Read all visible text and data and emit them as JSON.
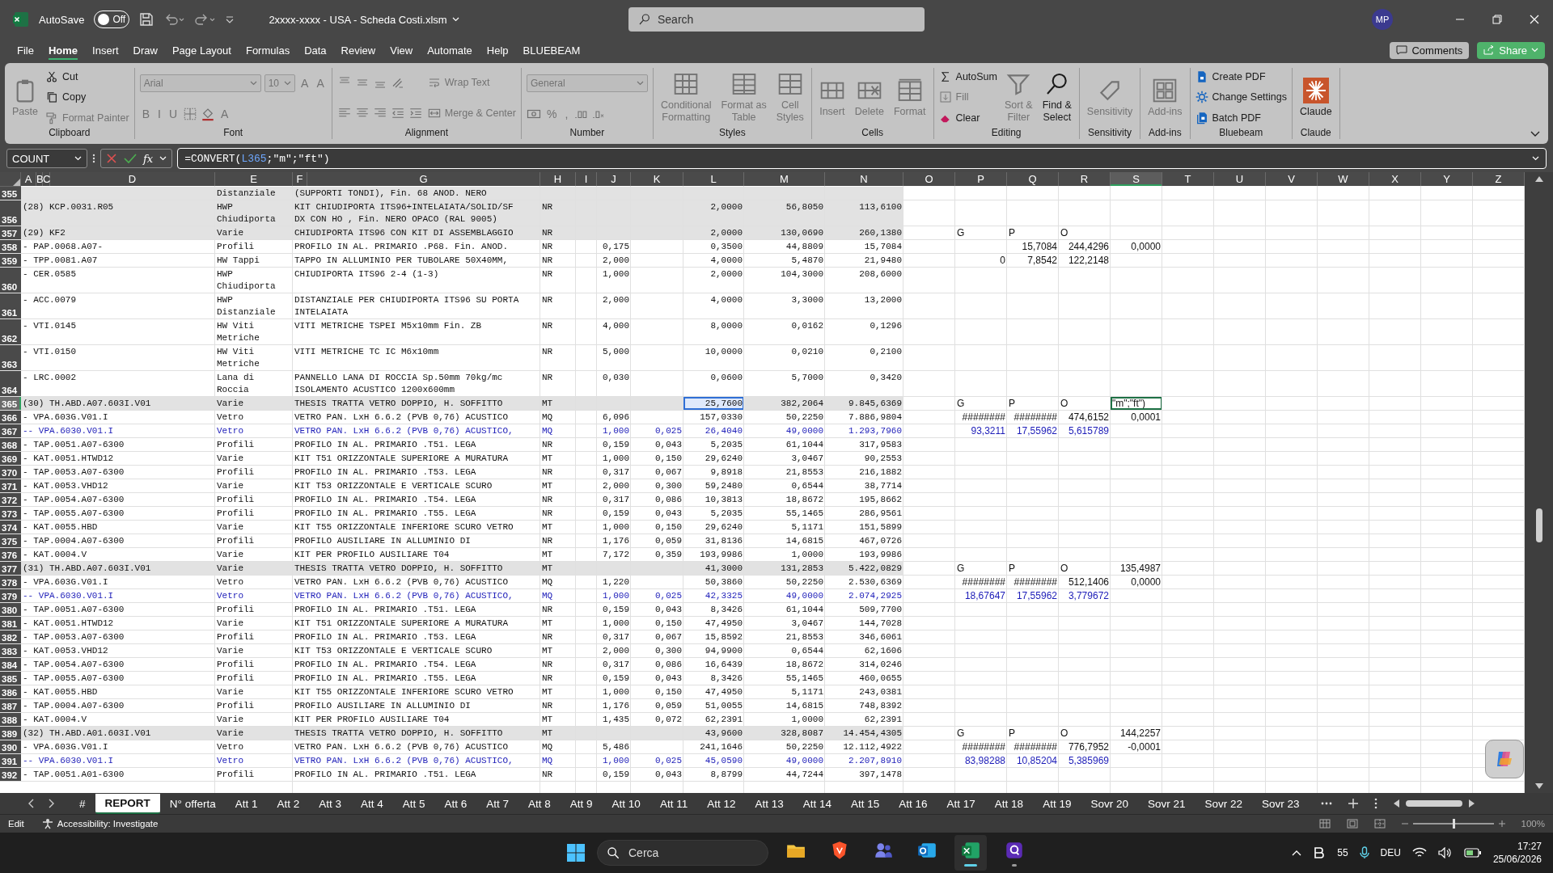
{
  "title_bar": {
    "autosave": {
      "label": "AutoSave",
      "on": false,
      "state_label": "Off"
    },
    "file_name": "2xxxx-xxxx - USA - Scheda Costi.xlsm",
    "search": {
      "placeholder": "Search"
    },
    "avatar": "MP"
  },
  "menu": {
    "tabs": [
      {
        "label": "File",
        "selected": false
      },
      {
        "label": "Home",
        "selected": true
      },
      {
        "label": "Insert",
        "selected": false
      },
      {
        "label": "Draw",
        "selected": false
      },
      {
        "label": "Page Layout",
        "selected": false
      },
      {
        "label": "Formulas",
        "selected": false
      },
      {
        "label": "Data",
        "selected": false
      },
      {
        "label": "Review",
        "selected": false
      },
      {
        "label": "View",
        "selected": false
      },
      {
        "label": "Automate",
        "selected": false
      },
      {
        "label": "Help",
        "selected": false
      },
      {
        "label": "BLUEBEAM",
        "selected": false
      }
    ],
    "comments": "Comments",
    "share": "Share"
  },
  "ribbon": [
    {
      "label": "Clipboard",
      "stacks": [
        [
          {
            "kind": "large",
            "label": "Paste",
            "disabled": true
          }
        ],
        [
          {
            "kind": "small",
            "label": "Cut",
            "disabled": false
          },
          {
            "kind": "small",
            "label": "Copy",
            "disabled": false
          },
          {
            "kind": "small",
            "label": "Format Painter",
            "disabled": true
          }
        ]
      ]
    },
    {
      "label": "Font",
      "stacks": [
        [
          {
            "kind": "row",
            "items": [
              {
                "kind": "select",
                "label": "Arial",
                "disabled": true
              },
              {
                "kind": "select",
                "label": "10",
                "disabled": true
              },
              {
                "kind": "glyph",
                "label": "A",
                "disabled": true
              },
              {
                "kind": "glyph",
                "label": "A",
                "disabled": true
              }
            ]
          },
          {
            "kind": "row",
            "items": [
              {
                "kind": "glyph",
                "label": "B",
                "disabled": true
              },
              {
                "kind": "glyph",
                "label": "I",
                "disabled": true
              },
              {
                "kind": "glyph",
                "label": "U",
                "disabled": true
              },
              {
                "kind": "icon",
                "disabled": true
              },
              {
                "kind": "icon",
                "disabled": true
              },
              {
                "kind": "glyph",
                "label": "A",
                "disabled": true
              }
            ]
          }
        ]
      ]
    },
    {
      "label": "Alignment",
      "stacks": [
        [
          {
            "kind": "row",
            "items": [
              {
                "kind": "icon",
                "disabled": true
              },
              {
                "kind": "icon",
                "disabled": true
              },
              {
                "kind": "icon",
                "disabled": true
              },
              {
                "kind": "icon",
                "disabled": true
              }
            ]
          },
          {
            "kind": "row",
            "items": [
              {
                "kind": "icon",
                "disabled": true
              },
              {
                "kind": "icon",
                "disabled": true
              },
              {
                "kind": "icon",
                "disabled": true
              },
              {
                "kind": "icon",
                "disabled": true
              },
              {
                "kind": "icon",
                "disabled": true
              }
            ]
          }
        ],
        [
          {
            "kind": "small",
            "label": "Wrap Text",
            "disabled": true
          },
          {
            "kind": "small",
            "label": "Merge & Center",
            "disabled": true
          }
        ]
      ]
    },
    {
      "label": "Number",
      "stacks": [
        [
          {
            "kind": "select",
            "label": "General",
            "disabled": true
          },
          {
            "kind": "row",
            "items": [
              {
                "kind": "icon",
                "disabled": true
              },
              {
                "kind": "glyph",
                "label": "%",
                "disabled": true
              },
              {
                "kind": "glyph",
                "label": ",",
                "disabled": true
              },
              {
                "kind": "icon",
                "disabled": true
              },
              {
                "kind": "icon",
                "disabled": true
              }
            ]
          }
        ]
      ]
    },
    {
      "label": "Styles",
      "stacks": [
        [
          {
            "kind": "large",
            "label": "Conditional\nFormatting",
            "disabled": true
          }
        ],
        [
          {
            "kind": "large",
            "label": "Format as\nTable",
            "disabled": true
          }
        ],
        [
          {
            "kind": "large",
            "label": "Cell\nStyles",
            "disabled": true
          }
        ]
      ]
    },
    {
      "label": "Cells",
      "stacks": [
        [
          {
            "kind": "large",
            "label": "Insert",
            "disabled": true
          }
        ],
        [
          {
            "kind": "large",
            "label": "Delete",
            "disabled": true
          }
        ],
        [
          {
            "kind": "large",
            "label": "Format",
            "disabled": true
          }
        ]
      ]
    },
    {
      "label": "Editing",
      "stacks": [
        [
          {
            "kind": "small",
            "label": "AutoSum",
            "disabled": false
          },
          {
            "kind": "small",
            "label": "Fill",
            "disabled": true
          },
          {
            "kind": "small",
            "label": "Clear",
            "disabled": false
          }
        ],
        [
          {
            "kind": "large",
            "label": "Sort &\nFilter",
            "disabled": true
          }
        ],
        [
          {
            "kind": "large",
            "label": "Find &\nSelect",
            "disabled": false
          }
        ]
      ]
    },
    {
      "label": "Sensitivity",
      "stacks": [
        [
          {
            "kind": "large",
            "label": "Sensitivity",
            "disabled": true
          }
        ]
      ]
    },
    {
      "label": "Add-ins",
      "stacks": [
        [
          {
            "kind": "large",
            "label": "Add-ins",
            "disabled": true
          }
        ]
      ]
    },
    {
      "label": "Bluebeam",
      "stacks": [
        [
          {
            "kind": "small",
            "label": "Create PDF",
            "disabled": false
          },
          {
            "kind": "small",
            "label": "Change Settings",
            "disabled": false
          },
          {
            "kind": "small",
            "label": "Batch PDF",
            "disabled": false
          }
        ]
      ]
    },
    {
      "label": "Claude",
      "stacks": [
        [
          {
            "kind": "large",
            "label": "Claude",
            "disabled": false
          }
        ]
      ]
    }
  ],
  "formula_bar": {
    "name_box": "COUNT",
    "function_label": "fx",
    "formula": [
      {
        "kind": "plain",
        "text": "=CONVERT("
      },
      {
        "kind": "ref",
        "text": "L365"
      },
      {
        "kind": "plain",
        "text": ";\"m\";\"ft\")"
      }
    ]
  },
  "sheet": {
    "columns": [
      {
        "label": "A",
        "selected": false
      },
      {
        "label": "B",
        "selected": false
      },
      {
        "label": "C",
        "selected": false
      },
      {
        "label": "D",
        "selected": false
      },
      {
        "label": "E",
        "selected": false
      },
      {
        "label": "F",
        "selected": false
      },
      {
        "label": "G",
        "selected": false
      },
      {
        "label": "H",
        "selected": false
      },
      {
        "label": "I",
        "selected": false
      },
      {
        "label": "J",
        "selected": false
      },
      {
        "label": "K",
        "selected": false
      },
      {
        "label": "L",
        "selected": false
      },
      {
        "label": "M",
        "selected": false
      },
      {
        "label": "N",
        "selected": false
      },
      {
        "label": "O",
        "selected": false
      },
      {
        "label": "P",
        "selected": false
      },
      {
        "label": "Q",
        "selected": false
      },
      {
        "label": "R",
        "selected": false
      },
      {
        "label": "S",
        "selected": true
      },
      {
        "label": "T",
        "selected": false
      },
      {
        "label": "U",
        "selected": false
      },
      {
        "label": "V",
        "selected": false
      },
      {
        "label": "W",
        "selected": false
      },
      {
        "label": "X",
        "selected": false
      },
      {
        "label": "Y",
        "selected": false
      },
      {
        "label": "Z",
        "selected": false
      }
    ],
    "rows": [
      {
        "number": "355",
        "kind": "group",
        "selected": false,
        "cells": {
          "E": "Distanziale",
          "F": "(SUPPORTI TONDI), Fin. 68 ANOD. NERO"
        }
      },
      {
        "number": "356",
        "kind": "group",
        "selected": false,
        "cells": {
          "A": "(28) KCP.0031.R05",
          "E": "HWP\nChiudiporta",
          "F": "KIT CHIUDIPORTA ITS96+INTELAIATA/SOLID/SF\nDX CON HO , Fin. NERO OPACO (RAL 9005)",
          "H": "NR",
          "L": "2,0000",
          "M": "56,8050",
          "N": "113,6100"
        }
      },
      {
        "number": "357",
        "kind": "group",
        "selected": false,
        "cells": {
          "A": "(29) KF2",
          "E": "Varie",
          "F": "CHIUDIPORTA ITS96 CON KIT DI ASSEMBLAGGIO",
          "H": "NR",
          "L": "2,0000",
          "M": "130,0690",
          "N": "260,1380",
          "P": "G",
          "Q": "P",
          "R": "O"
        }
      },
      {
        "number": "358",
        "kind": "item",
        "selected": false,
        "cells": {
          "A": "- PAP.0068.A07-",
          "E": "Profili",
          "F": "PROFILO IN AL. PRIMARIO .P68. Fin. ANOD.",
          "H": "NR",
          "J": "0,175",
          "L": "0,3500",
          "M": "44,8809",
          "N": "15,7084",
          "Q": "15,7084",
          "R": "244,4296",
          "S": "0,0000"
        }
      },
      {
        "number": "359",
        "kind": "item",
        "selected": false,
        "cells": {
          "A": "- TPP.0081.A07",
          "E": "HW Tappi",
          "F": "TAPPO IN ALLUMINIO PER TUBOLARE 50X40MM,",
          "H": "NR",
          "J": "2,000",
          "L": "4,0000",
          "M": "5,4870",
          "N": "21,9480",
          "P": "0",
          "Q": "7,8542",
          "R": "122,2148"
        }
      },
      {
        "number": "360",
        "kind": "item",
        "selected": false,
        "cells": {
          "A": "- CER.0585",
          "E": "HWP\nChiudiporta",
          "F": "CHIUDIPORTA ITS96 2-4 (1-3)",
          "H": "NR",
          "J": "1,000",
          "L": "2,0000",
          "M": "104,3000",
          "N": "208,6000"
        }
      },
      {
        "number": "361",
        "kind": "item",
        "selected": false,
        "cells": {
          "A": "- ACC.0079",
          "E": "HWP\nDistanziale",
          "F": "DISTANZIALE PER CHIUDIPORTA ITS96 SU PORTA\nINTELAIATA",
          "H": "NR",
          "J": "2,000",
          "L": "4,0000",
          "M": "3,3000",
          "N": "13,2000"
        }
      },
      {
        "number": "362",
        "kind": "item",
        "selected": false,
        "cells": {
          "A": "- VTI.0145",
          "E": "HW Viti\nMetriche",
          "F": "VITI METRICHE TSPEI M5x10mm Fin. ZB",
          "H": "NR",
          "J": "4,000",
          "L": "8,0000",
          "M": "0,0162",
          "N": "0,1296"
        }
      },
      {
        "number": "363",
        "kind": "item",
        "selected": false,
        "cells": {
          "A": "- VTI.0150",
          "E": "HW Viti\nMetriche",
          "F": "VITI METRICHE TC IC M6x10mm",
          "H": "NR",
          "J": "5,000",
          "L": "10,0000",
          "M": "0,0210",
          "N": "0,2100"
        }
      },
      {
        "number": "364",
        "kind": "item",
        "selected": false,
        "cells": {
          "A": "- LRC.0002",
          "E": "Lana di\nRoccia",
          "F": "PANNELLO LANA DI ROCCIA Sp.50mm 70kg/mc\nISOLAMENTO ACUSTICO 1200x600mm",
          "H": "NR",
          "J": "0,030",
          "L": "0,0600",
          "M": "5,7000",
          "N": "0,3420"
        }
      },
      {
        "number": "365",
        "kind": "group",
        "selected": true,
        "cells": {
          "A": "(30) TH.ABD.A07.603I.V01",
          "E": "Varie",
          "F": "THESIS TRATTA VETRO DOPPIO, H. SOFFITTO",
          "H": "MT",
          "L": {
            "text": "25,7600",
            "referenced": true
          },
          "M": "382,2064",
          "N": "9.845,6369",
          "P": "G",
          "Q": "P",
          "R": "O",
          "S": {
            "text": "\"m\";\"ft\")",
            "selected": true
          }
        }
      },
      {
        "number": "366",
        "kind": "item",
        "selected": false,
        "cells": {
          "A": "- VPA.603G.V01.I",
          "E": "Vetro",
          "F": "VETRO PAN. LxH 6.6.2 (PVB 0,76) ACUSTICO",
          "H": "MQ",
          "J": "6,096",
          "L": "157,0330",
          "M": "50,2250",
          "N": "7.886,9804",
          "P": "########",
          "Q": "########",
          "R": "474,6152",
          "S": "0,0001"
        }
      },
      {
        "number": "367",
        "kind": "sub",
        "selected": false,
        "cells": {
          "A": "-- VPA.6030.V01.I",
          "E": "Vetro",
          "F": "VETRO PAN. LxH 6.6.2 (PVB 0,76) ACUSTICO,",
          "H": "MQ",
          "J": "1,000",
          "K": "0,025",
          "L": "26,4040",
          "M": "49,0000",
          "N": "1.293,7960",
          "P": "93,3211",
          "Q": "17,55962",
          "R": "5,615789"
        }
      },
      {
        "number": "368",
        "kind": "item",
        "selected": false,
        "cells": {
          "A": "- TAP.0051.A07-6300",
          "E": "Profili",
          "F": "PROFILO IN AL. PRIMARIO .T51. LEGA",
          "H": "NR",
          "J": "0,159",
          "K": "0,043",
          "L": "5,2035",
          "M": "61,1044",
          "N": "317,9583"
        }
      },
      {
        "number": "369",
        "kind": "item",
        "selected": false,
        "cells": {
          "A": "- KAT.0051.HTWD12",
          "E": "Varie",
          "F": "KIT T51 ORIZZONTALE SUPERIORE A MURATURA",
          "H": "MT",
          "J": "1,000",
          "K": "0,150",
          "L": "29,6240",
          "M": "3,0467",
          "N": "90,2553"
        }
      },
      {
        "number": "370",
        "kind": "item",
        "selected": false,
        "cells": {
          "A": "- TAP.0053.A07-6300",
          "E": "Profili",
          "F": "PROFILO IN AL. PRIMARIO .T53. LEGA",
          "H": "NR",
          "J": "0,317",
          "K": "0,067",
          "L": "9,8918",
          "M": "21,8553",
          "N": "216,1882"
        }
      },
      {
        "number": "371",
        "kind": "item",
        "selected": false,
        "cells": {
          "A": "- KAT.0053.VHD12",
          "E": "Varie",
          "F": "KIT T53 ORIZZONTALE E VERTICALE SCURO",
          "H": "MT",
          "J": "2,000",
          "K": "0,300",
          "L": "59,2480",
          "M": "0,6544",
          "N": "38,7714"
        }
      },
      {
        "number": "372",
        "kind": "item",
        "selected": false,
        "cells": {
          "A": "- TAP.0054.A07-6300",
          "E": "Profili",
          "F": "PROFILO IN AL. PRIMARIO .T54. LEGA",
          "H": "NR",
          "J": "0,317",
          "K": "0,086",
          "L": "10,3813",
          "M": "18,8672",
          "N": "195,8662"
        }
      },
      {
        "number": "373",
        "kind": "item",
        "selected": false,
        "cells": {
          "A": "- TAP.0055.A07-6300",
          "E": "Profili",
          "F": "PROFILO IN AL. PRIMARIO .T55. LEGA",
          "H": "NR",
          "J": "0,159",
          "K": "0,043",
          "L": "5,2035",
          "M": "55,1465",
          "N": "286,9561"
        }
      },
      {
        "number": "374",
        "kind": "item",
        "selected": false,
        "cells": {
          "A": "- KAT.0055.HBD",
          "E": "Varie",
          "F": "KIT T55 ORIZZONTALE INFERIORE SCURO VETRO",
          "H": "MT",
          "J": "1,000",
          "K": "0,150",
          "L": "29,6240",
          "M": "5,1171",
          "N": "151,5899"
        }
      },
      {
        "number": "375",
        "kind": "item",
        "selected": false,
        "cells": {
          "A": "- TAP.0004.A07-6300",
          "E": "Profili",
          "F": "PROFILO AUSILIARE IN ALLUMINIO DI",
          "H": "NR",
          "J": "1,176",
          "K": "0,059",
          "L": "31,8136",
          "M": "14,6815",
          "N": "467,0726"
        }
      },
      {
        "number": "376",
        "kind": "item",
        "selected": false,
        "cells": {
          "A": "- KAT.0004.V",
          "E": "Varie",
          "F": "KIT PER PROFILO AUSILIARE T04",
          "H": "MT",
          "J": "7,172",
          "K": "0,359",
          "L": "193,9986",
          "M": "1,0000",
          "N": "193,9986"
        }
      },
      {
        "number": "377",
        "kind": "group",
        "selected": false,
        "cells": {
          "A": "(31) TH.ABD.A07.603I.V01",
          "E": "Varie",
          "F": "THESIS TRATTA VETRO DOPPIO, H. SOFFITTO",
          "H": "MT",
          "L": "41,3000",
          "M": "131,2853",
          "N": "5.422,0829",
          "P": "G",
          "Q": "P",
          "R": "O",
          "S": "135,4987"
        }
      },
      {
        "number": "378",
        "kind": "item",
        "selected": false,
        "cells": {
          "A": "- VPA.603G.V01.I",
          "E": "Vetro",
          "F": "VETRO PAN. LxH 6.6.2 (PVB 0,76) ACUSTICO",
          "H": "MQ",
          "J": "1,220",
          "L": "50,3860",
          "M": "50,2250",
          "N": "2.530,6369",
          "P": "########",
          "Q": "########",
          "R": "512,1406",
          "S": "0,0000"
        }
      },
      {
        "number": "379",
        "kind": "sub",
        "selected": false,
        "cells": {
          "A": "-- VPA.6030.V01.I",
          "E": "Vetro",
          "F": "VETRO PAN. LxH 6.6.2 (PVB 0,76) ACUSTICO,",
          "H": "MQ",
          "J": "1,000",
          "K": "0,025",
          "L": "42,3325",
          "M": "49,0000",
          "N": "2.074,2925",
          "P": "18,67647",
          "Q": "17,55962",
          "R": "3,779672"
        }
      },
      {
        "number": "380",
        "kind": "item",
        "selected": false,
        "cells": {
          "A": "- TAP.0051.A07-6300",
          "E": "Profili",
          "F": "PROFILO IN AL. PRIMARIO .T51. LEGA",
          "H": "NR",
          "J": "0,159",
          "K": "0,043",
          "L": "8,3426",
          "M": "61,1044",
          "N": "509,7700"
        }
      },
      {
        "number": "381",
        "kind": "item",
        "selected": false,
        "cells": {
          "A": "- KAT.0051.HTWD12",
          "E": "Varie",
          "F": "KIT T51 ORIZZONTALE SUPERIORE A MURATURA",
          "H": "MT",
          "J": "1,000",
          "K": "0,150",
          "L": "47,4950",
          "M": "3,0467",
          "N": "144,7028"
        }
      },
      {
        "number": "382",
        "kind": "item",
        "selected": false,
        "cells": {
          "A": "- TAP.0053.A07-6300",
          "E": "Profili",
          "F": "PROFILO IN AL. PRIMARIO .T53. LEGA",
          "H": "NR",
          "J": "0,317",
          "K": "0,067",
          "L": "15,8592",
          "M": "21,8553",
          "N": "346,6061"
        }
      },
      {
        "number": "383",
        "kind": "item",
        "selected": false,
        "cells": {
          "A": "- KAT.0053.VHD12",
          "E": "Varie",
          "F": "KIT T53 ORIZZONTALE E VERTICALE SCURO",
          "H": "MT",
          "J": "2,000",
          "K": "0,300",
          "L": "94,9900",
          "M": "0,6544",
          "N": "62,1606"
        }
      },
      {
        "number": "384",
        "kind": "item",
        "selected": false,
        "cells": {
          "A": "- TAP.0054.A07-6300",
          "E": "Profili",
          "F": "PROFILO IN AL. PRIMARIO .T54. LEGA",
          "H": "NR",
          "J": "0,317",
          "K": "0,086",
          "L": "16,6439",
          "M": "18,8672",
          "N": "314,0246"
        }
      },
      {
        "number": "385",
        "kind": "item",
        "selected": false,
        "cells": {
          "A": "- TAP.0055.A07-6300",
          "E": "Profili",
          "F": "PROFILO IN AL. PRIMARIO .T55. LEGA",
          "H": "NR",
          "J": "0,159",
          "K": "0,043",
          "L": "8,3426",
          "M": "55,1465",
          "N": "460,0655"
        }
      },
      {
        "number": "386",
        "kind": "item",
        "selected": false,
        "cells": {
          "A": "- KAT.0055.HBD",
          "E": "Varie",
          "F": "KIT T55 ORIZZONTALE INFERIORE SCURO VETRO",
          "H": "MT",
          "J": "1,000",
          "K": "0,150",
          "L": "47,4950",
          "M": "5,1171",
          "N": "243,0381"
        }
      },
      {
        "number": "387",
        "kind": "item",
        "selected": false,
        "cells": {
          "A": "- TAP.0004.A07-6300",
          "E": "Profili",
          "F": "PROFILO AUSILIARE IN ALLUMINIO DI",
          "H": "NR",
          "J": "1,176",
          "K": "0,059",
          "L": "51,0055",
          "M": "14,6815",
          "N": "748,8392"
        }
      },
      {
        "number": "388",
        "kind": "item",
        "selected": false,
        "cells": {
          "A": "- KAT.0004.V",
          "E": "Varie",
          "F": "KIT PER PROFILO AUSILIARE T04",
          "H": "MT",
          "J": "1,435",
          "K": "0,072",
          "L": "62,2391",
          "M": "1,0000",
          "N": "62,2391"
        }
      },
      {
        "number": "389",
        "kind": "group",
        "selected": false,
        "cells": {
          "A": "(32) TH.ABD.A01.603I.V01",
          "E": "Varie",
          "F": "THESIS TRATTA VETRO DOPPIO, H. SOFFITTO",
          "H": "MT",
          "L": "43,9600",
          "M": "328,8087",
          "N": "14.454,4305",
          "P": "G",
          "Q": "P",
          "R": "O",
          "S": "144,2257"
        }
      },
      {
        "number": "390",
        "kind": "item",
        "selected": false,
        "cells": {
          "A": "- VPA.603G.V01.I",
          "E": "Vetro",
          "F": "VETRO PAN. LxH 6.6.2 (PVB 0,76) ACUSTICO",
          "H": "MQ",
          "J": "5,486",
          "L": "241,1646",
          "M": "50,2250",
          "N": "12.112,4922",
          "P": "########",
          "Q": "########",
          "R": "776,7952",
          "S": "-0,0001"
        }
      },
      {
        "number": "391",
        "kind": "sub",
        "selected": false,
        "cells": {
          "A": "-- VPA.6030.V01.I",
          "E": "Vetro",
          "F": "VETRO PAN. LxH 6.6.2 (PVB 0,76) ACUSTICO,",
          "H": "MQ",
          "J": "1,000",
          "K": "0,025",
          "L": "45,0590",
          "M": "49,0000",
          "N": "2.207,8910",
          "P": "83,98288",
          "Q": "10,85204",
          "R": "5,385969"
        }
      },
      {
        "number": "392",
        "kind": "item",
        "selected": false,
        "cells": {
          "A": "- TAP.0051.A01-6300",
          "E": "Profili",
          "F": "PROFILO IN AL. PRIMARIO .T51. LEGA",
          "H": "NR",
          "J": "0,159",
          "K": "0,043",
          "L": "8,8799",
          "M": "44,7244",
          "N": "397,1478"
        }
      }
    ]
  },
  "sheet_tabs": [
    {
      "label": "#",
      "selected": false
    },
    {
      "label": "REPORT",
      "selected": true
    },
    {
      "label": "N° offerta",
      "selected": false
    },
    {
      "label": "Att 1",
      "selected": false
    },
    {
      "label": "Att 2",
      "selected": false
    },
    {
      "label": "Att 3",
      "selected": false
    },
    {
      "label": "Att 4",
      "selected": false
    },
    {
      "label": "Att 5",
      "selected": false
    },
    {
      "label": "Att 6",
      "selected": false
    },
    {
      "label": "Att 7",
      "selected": false
    },
    {
      "label": "Att 8",
      "selected": false
    },
    {
      "label": "Att 9",
      "selected": false
    },
    {
      "label": "Att 10",
      "selected": false
    },
    {
      "label": "Att 11",
      "selected": false
    },
    {
      "label": "Att 12",
      "selected": false
    },
    {
      "label": "Att 13",
      "selected": false
    },
    {
      "label": "Att 14",
      "selected": false
    },
    {
      "label": "Att 15",
      "selected": false
    },
    {
      "label": "Att 16",
      "selected": false
    },
    {
      "label": "Att 17",
      "selected": false
    },
    {
      "label": "Att 18",
      "selected": false
    },
    {
      "label": "Att 19",
      "selected": false
    },
    {
      "label": "Sovr 20",
      "selected": false
    },
    {
      "label": "Sovr 21",
      "selected": false
    },
    {
      "label": "Sovr 22",
      "selected": false
    },
    {
      "label": "Sovr 23",
      "selected": false
    }
  ],
  "status_bar": {
    "mode": "Edit",
    "accessibility": "Accessibility: Investigate",
    "zoom": {
      "level": 0.5,
      "reading": "100%"
    }
  },
  "taskbar": {
    "search": {
      "placeholder": "Cerca"
    },
    "apps": [
      {
        "selected": false,
        "running": false
      },
      {
        "selected": false,
        "running": false
      },
      {
        "selected": false,
        "running": false
      },
      {
        "selected": false,
        "running": false
      },
      {
        "selected": true,
        "running": true
      },
      {
        "selected": false,
        "running": true
      }
    ],
    "tray_count": "55",
    "language": "DEU",
    "time": "17:27",
    "date": "25/06/2026"
  }
}
